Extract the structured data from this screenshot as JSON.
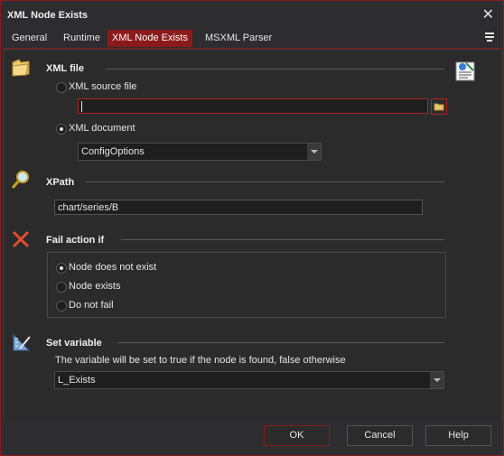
{
  "window": {
    "title": "XML Node Exists"
  },
  "tabs": [
    {
      "label": "General"
    },
    {
      "label": "Runtime"
    },
    {
      "label": "XML Node Exists"
    },
    {
      "label": "MSXML Parser"
    }
  ],
  "xml_file": {
    "title": "XML file",
    "source_file_label": "XML source file",
    "source_file_value": "",
    "document_label": "XML document",
    "document_value": "ConfigOptions"
  },
  "xpath": {
    "title": "XPath",
    "value": "chart/series/B"
  },
  "fail_action": {
    "title": "Fail action if",
    "options": [
      {
        "label": "Node does not exist",
        "checked": true
      },
      {
        "label": "Node exists",
        "checked": false
      },
      {
        "label": "Do not fail",
        "checked": false
      }
    ]
  },
  "set_variable": {
    "title": "Set variable",
    "description": "The variable will be set to true if the node is found, false otherwise",
    "value": "L_Exists"
  },
  "buttons": {
    "ok": "OK",
    "cancel": "Cancel",
    "help": "Help"
  },
  "colors": {
    "accent": "#8b1a1a",
    "background": "#2b2b2b",
    "error_border": "#b22222"
  },
  "icons": {
    "close": "close-icon",
    "folder": "folder-icon",
    "xml_doc": "xml-document-icon",
    "xpath": "magnifier-icon",
    "fail": "red-x-icon",
    "variable": "ruler-icon"
  }
}
